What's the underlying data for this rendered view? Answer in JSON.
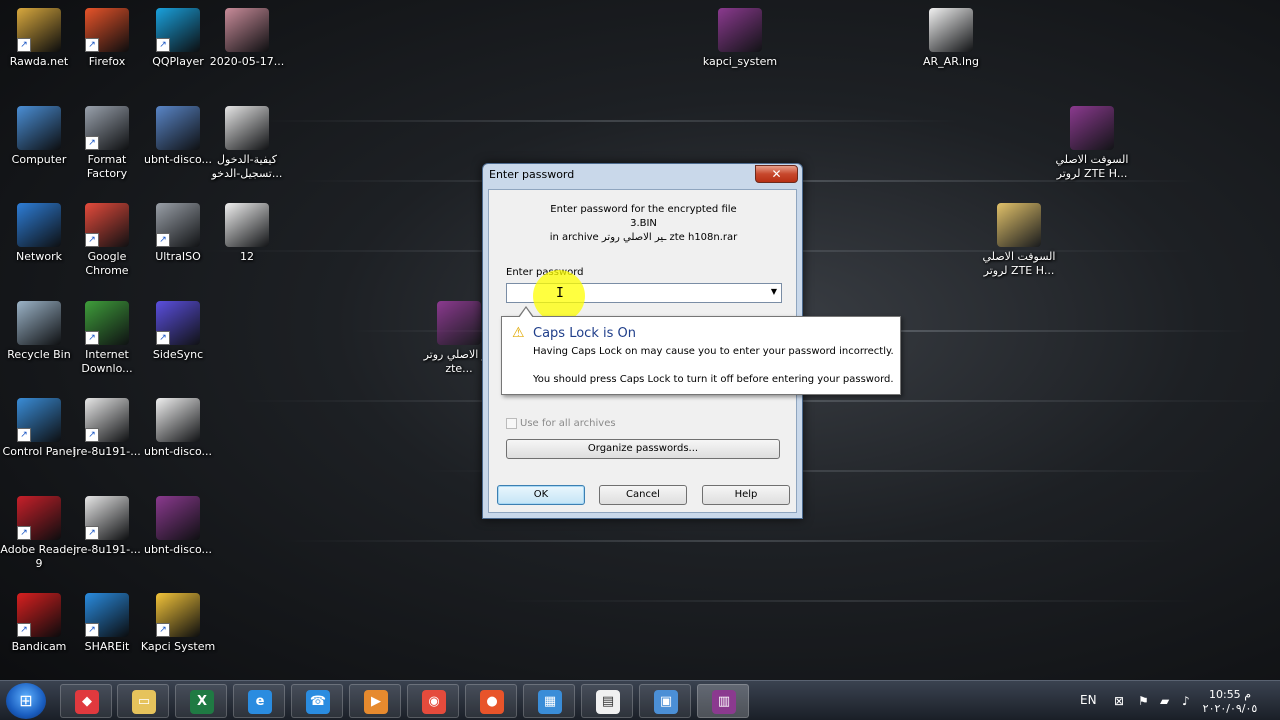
{
  "desktop_icons": [
    {
      "id": "rawda",
      "label": "Rawda.net",
      "icon": "folder-user-icon",
      "color": "#d9a93e"
    },
    {
      "id": "firefox",
      "label": "Firefox",
      "icon": "firefox-icon",
      "color": "#e8542a"
    },
    {
      "id": "qqplayer",
      "label": "QQPlayer",
      "icon": "qqplayer-icon",
      "color": "#1aa2de"
    },
    {
      "id": "date-file",
      "label": "2020-05-17...",
      "icon": "image-file-icon",
      "color": "#c98c9a"
    },
    {
      "id": "computer",
      "label": "Computer",
      "icon": "computer-icon",
      "color": "#4b8fd6"
    },
    {
      "id": "format-factory",
      "label": "Format Factory",
      "icon": "format-factory-icon",
      "color": "#9aa2ad"
    },
    {
      "id": "ubnt1",
      "label": "ubnt-disco...",
      "icon": "gear-file-icon",
      "color": "#5a86c8"
    },
    {
      "id": "arabic-login",
      "label": "كيفية-الدخول تسجيل-الدخو...",
      "icon": "document-file-icon",
      "color": "#e6e6e6"
    },
    {
      "id": "network",
      "label": "Network",
      "icon": "network-icon",
      "color": "#2e7ed8"
    },
    {
      "id": "chrome",
      "label": "Google Chrome",
      "icon": "chrome-icon",
      "color": "#e54b3c"
    },
    {
      "id": "ultraiso",
      "label": "UltraISO",
      "icon": "disc-icon",
      "color": "#9aa0a8"
    },
    {
      "id": "file12",
      "label": "12",
      "icon": "document-file-icon",
      "color": "#f0f0f0"
    },
    {
      "id": "recycle",
      "label": "Recycle Bin",
      "icon": "recycle-bin-icon",
      "color": "#9cb4c8"
    },
    {
      "id": "idm",
      "label": "Internet Downlo...",
      "icon": "download-manager-icon",
      "color": "#3f9e3b"
    },
    {
      "id": "sidesync",
      "label": "SideSync",
      "icon": "sidesync-icon",
      "color": "#5b4fe0"
    },
    {
      "id": "control-panel",
      "label": "Control Panel",
      "icon": "control-panel-icon",
      "color": "#3a8dd8"
    },
    {
      "id": "jre1",
      "label": "jre-8u191-...",
      "icon": "java-icon",
      "color": "#e7e7e7"
    },
    {
      "id": "ubnt2",
      "label": "ubnt-disco...",
      "icon": "document-file-icon",
      "color": "#f0f0f0"
    },
    {
      "id": "adobe",
      "label": "Adobe Reader 9",
      "icon": "adobe-reader-icon",
      "color": "#c8202a"
    },
    {
      "id": "jre2",
      "label": "jre-8u191-...",
      "icon": "java-icon",
      "color": "#e7e7e7"
    },
    {
      "id": "ubnt3",
      "label": "ubnt-disco...",
      "icon": "winrar-icon",
      "color": "#8b3a8f"
    },
    {
      "id": "bandicam",
      "label": "Bandicam",
      "icon": "bandicam-icon",
      "color": "#d92020"
    },
    {
      "id": "shareit",
      "label": "SHAREit",
      "icon": "shareit-icon",
      "color": "#2a8ce0"
    },
    {
      "id": "kapci",
      "label": "Kapci System",
      "icon": "kapci-icon",
      "color": "#f3c43a"
    },
    {
      "id": "kapci-system",
      "label": "kapci_system",
      "icon": "winrar-icon",
      "color": "#8b3a8f"
    },
    {
      "id": "ar-ar",
      "label": "AR_AR.lng",
      "icon": "blank-file-icon",
      "color": "#f2f2f2"
    },
    {
      "id": "zte-rar",
      "label": "السوفت الاصلي لروتر ZTE H...",
      "icon": "winrar-icon",
      "color": "#8b3a8f"
    },
    {
      "id": "zte-folder",
      "label": "السوفت الاصلي لروتر ZTE H...",
      "icon": "folder-icon",
      "color": "#e2c26a"
    },
    {
      "id": "mid-rar",
      "label": "ـير الاصلي روتر zte...",
      "icon": "winrar-icon",
      "color": "#8b3a8f"
    }
  ],
  "dialog": {
    "title": "Enter password",
    "close_glyph": "✕",
    "info_line1": "Enter password for the encrypted file",
    "info_line2": "3.BIN",
    "info_line3": "in archive ـير الاصلي روتر zte h108n.rar",
    "password_label": "Enter password",
    "password_value": "",
    "use_for_all_label": "Use for all archives",
    "organize_label": "Organize passwords...",
    "ok_label": "OK",
    "cancel_label": "Cancel",
    "help_label": "Help"
  },
  "tooltip": {
    "title": "Caps Lock is On",
    "line1": "Having Caps Lock on may cause you to enter your password incorrectly.",
    "line2": "You should press Caps Lock to turn it off before entering your password."
  },
  "taskbar": {
    "items": [
      {
        "id": "anydesk",
        "icon": "anydesk-icon",
        "color": "#e0393e",
        "glyph": "◆"
      },
      {
        "id": "explorer",
        "icon": "file-explorer-icon",
        "color": "#e6c35c",
        "glyph": "▭"
      },
      {
        "id": "excel",
        "icon": "excel-icon",
        "color": "#1f7a43",
        "glyph": "X"
      },
      {
        "id": "ie",
        "icon": "internet-explorer-icon",
        "color": "#2a8ce0",
        "glyph": "e"
      },
      {
        "id": "skype",
        "icon": "phone-app-icon",
        "color": "#2a8ce0",
        "glyph": "☎"
      },
      {
        "id": "media",
        "icon": "media-player-icon",
        "color": "#e68a2e",
        "glyph": "▶"
      },
      {
        "id": "chrome",
        "icon": "chrome-icon",
        "color": "#e54b3c",
        "glyph": "◉"
      },
      {
        "id": "firefox",
        "icon": "firefox-icon",
        "color": "#e8542a",
        "glyph": "●"
      },
      {
        "id": "control",
        "icon": "control-panel-icon",
        "color": "#3a8dd8",
        "glyph": "▦"
      },
      {
        "id": "doc",
        "icon": "document-icon",
        "color": "#f0f0f0",
        "glyph": "▤"
      },
      {
        "id": "image",
        "icon": "image-viewer-icon",
        "color": "#4b8fd6",
        "glyph": "▣"
      },
      {
        "id": "winrar",
        "icon": "winrar-icon",
        "color": "#8b3a8f",
        "glyph": "▥"
      }
    ],
    "language": "EN",
    "time": "10:55 م",
    "date": "٢٠٢٠/٠٩/٠٥"
  }
}
